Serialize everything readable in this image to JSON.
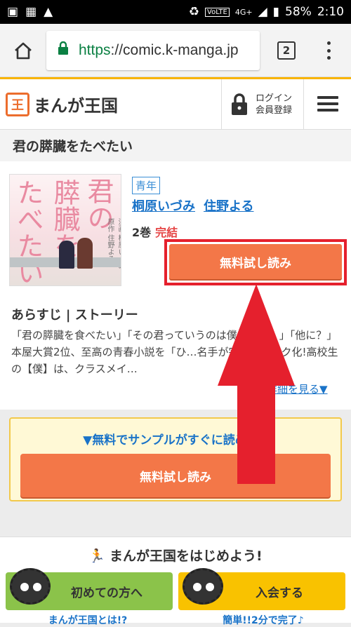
{
  "status_bar": {
    "battery": "58%",
    "time": "2:10",
    "network": "4G+",
    "volte": "VoLTE"
  },
  "browser": {
    "url_scheme": "https",
    "url_rest": "://comic.k-manga.jp",
    "tab_count": "2"
  },
  "header": {
    "logo_mark": "王",
    "logo_text": "まんが王国",
    "login_line1": "ログイン",
    "login_line2": "会員登録"
  },
  "page": {
    "title": "君の膵臓をたべたい",
    "cover_title": [
      "君の",
      "膵臓を",
      "たべたい"
    ],
    "cover_sub1": "原作 住野よる",
    "cover_sub2": "漫画 桐原いづみ",
    "genre": "青年",
    "authors": [
      "桐原いづみ",
      "住野よる"
    ],
    "volumes": "2巻",
    "status": "完結",
    "read_button": "無料試し読み",
    "synopsis_heading": "あらすじ | ストーリー",
    "synopsis_text": "「君の膵臓を食べたい」「その君っていうのは僕のこと？」「他に？」本屋大賞2位、至高の青春小説を「ひ…名手が完全コミック化!高校生の【僕】は、クラスメイ…",
    "more_link": "詳細を見る▼"
  },
  "sample": {
    "label": "▼無料でサンプルがすぐに読める▼",
    "button": "無料試し読み"
  },
  "join": {
    "heading": "まんが王国をはじめよう!",
    "first_button": "初めての方へ",
    "join_button": "入会する",
    "link1": "まんが王国とは!?",
    "link2": "簡単!!2分で完了♪"
  },
  "colors": {
    "accent": "#f37748",
    "highlight": "#e5202d",
    "link": "#1a73c8"
  }
}
